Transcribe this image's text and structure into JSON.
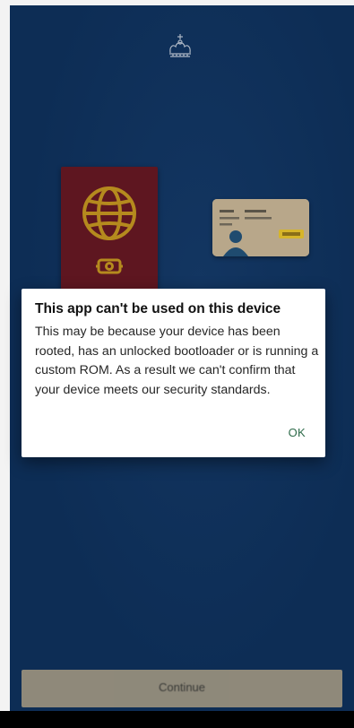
{
  "colors": {
    "screen_background": "#0d2d55",
    "passport": "#5e1620",
    "passport_emblem": "#b58a1e",
    "id_card": "#b8a78a",
    "dialog_background": "#ffffff",
    "ok_button": "#2e6b4a",
    "continue_button": "#9a917e",
    "nav_bar": "#000000"
  },
  "header": {
    "logo_icon": "crown-icon"
  },
  "illustration": {
    "passport_icon": "passport-icon",
    "id_card_icon": "id-card-icon"
  },
  "dialog": {
    "title": "This app can't be used on this device",
    "body": "This may be because your device has been rooted, has an unlocked bootloader or is running a custom ROM. As a result we can't confirm that your device meets our security standards.",
    "ok_label": "OK"
  },
  "footer": {
    "continue_label": "Continue"
  }
}
